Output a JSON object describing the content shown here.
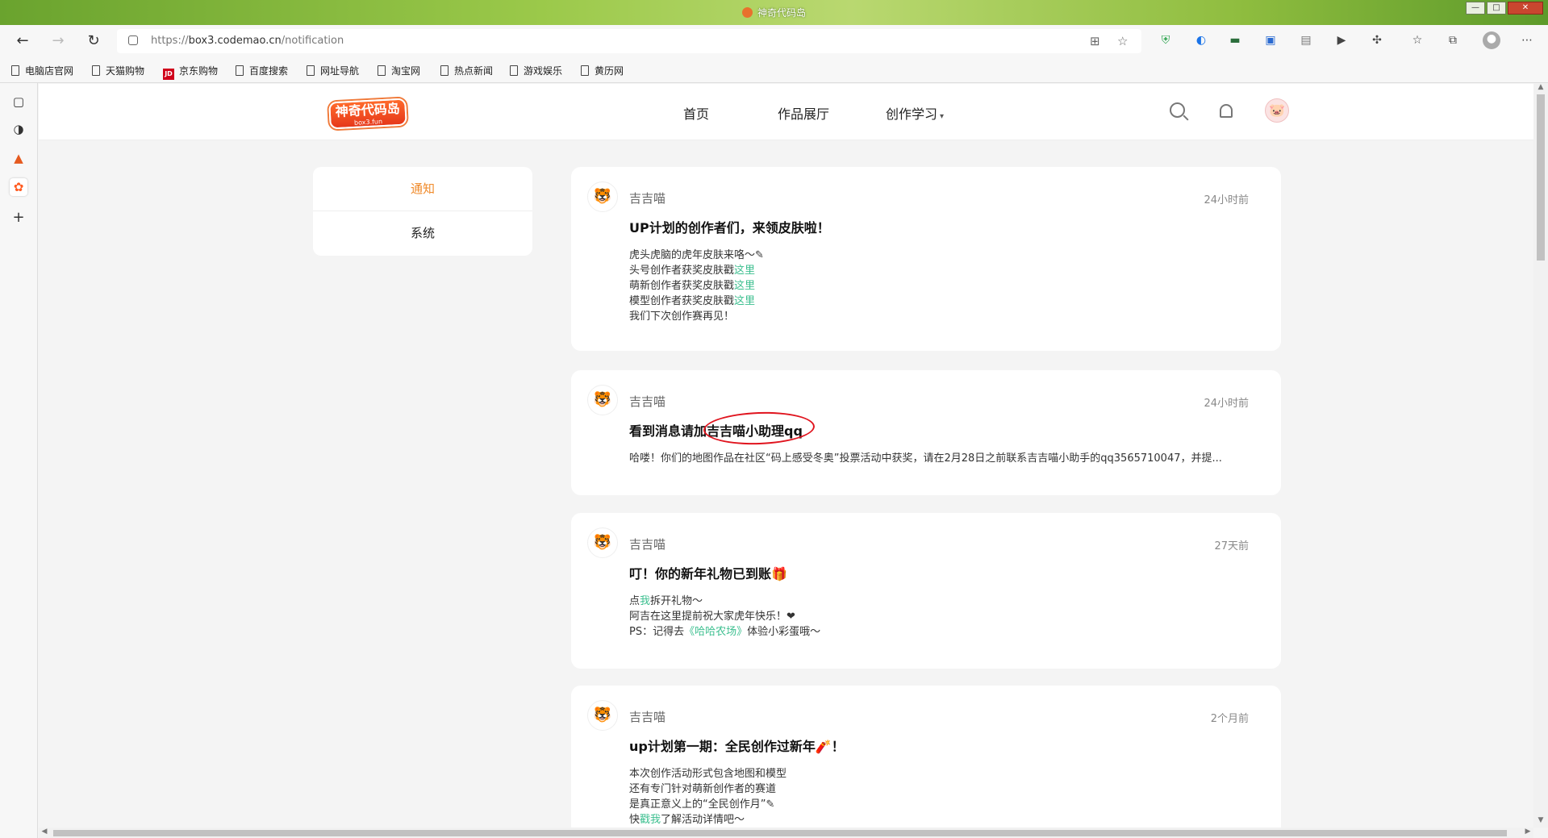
{
  "window": {
    "title": "神奇代码岛",
    "min": "—",
    "max": "□",
    "close": "✕"
  },
  "toolbar": {
    "url_prefix": "https://",
    "url_host": "box3.codemao.cn",
    "url_path": "/notification"
  },
  "bookmarks": [
    {
      "label": "电脑店官网",
      "icon": "page"
    },
    {
      "label": "天猫购物",
      "icon": "page"
    },
    {
      "label": "京东购物",
      "icon": "jd",
      "icon_text": "JD"
    },
    {
      "label": "百度搜索",
      "icon": "page"
    },
    {
      "label": "网址导航",
      "icon": "page"
    },
    {
      "label": "淘宝网",
      "icon": "page"
    },
    {
      "label": "热点新闻",
      "icon": "page"
    },
    {
      "label": "游戏娱乐",
      "icon": "page"
    },
    {
      "label": "黄历网",
      "icon": "page"
    }
  ],
  "site": {
    "logo_text": "神奇代码岛",
    "logo_sub": "box3.fun",
    "nav": [
      "首页",
      "作品展厅",
      "创作学习"
    ],
    "nav_caret": "▾"
  },
  "side_tabs": {
    "notify": "通知",
    "system": "系统"
  },
  "cards": [
    {
      "sender": "吉吉喵",
      "time": "24小时前",
      "title": "UP计划的创作者们，来领皮肤啦！",
      "lines": [
        {
          "text": "虎头虎脑的虎年皮肤来咯～✎",
          "link": ""
        },
        {
          "text": "头号创作者获奖皮肤戳",
          "link": "这里"
        },
        {
          "text": "萌新创作者获奖皮肤戳",
          "link": "这里"
        },
        {
          "text": "模型创作者获奖皮肤戳",
          "link": "这里"
        },
        {
          "text": "我们下次创作赛再见！",
          "link": ""
        }
      ]
    },
    {
      "sender": "吉吉喵",
      "time": "24小时前",
      "title": "看到消息请加吉吉喵小助理qq",
      "lines": [
        {
          "text": "哈喽！你们的地图作品在社区“码上感受冬奥”投票活动中获奖，请在2月28日之前联系吉吉喵小助手的qq3565710047，并提...",
          "link": ""
        }
      ]
    },
    {
      "sender": "吉吉喵",
      "time": "27天前",
      "title": "叮！你的新年礼物已到账🎁",
      "lines": [
        {
          "pre": "点",
          "link": "我",
          "post": "拆开礼物～"
        },
        {
          "pre": "阿吉在这里提前祝大家虎年快乐！❤",
          "link": "",
          "post": ""
        },
        {
          "pre": "PS：记得去",
          "link": "《哈哈农场》",
          "post": "体验小彩蛋哦～"
        }
      ]
    },
    {
      "sender": "吉吉喵",
      "time": "2个月前",
      "title": " up计划第一期：全民创作过新年🧨！",
      "lines": [
        {
          "pre": "本次创作活动形式包含地图和模型",
          "link": "",
          "post": ""
        },
        {
          "pre": "还有专门针对萌新创作者的赛道",
          "link": "",
          "post": ""
        },
        {
          "pre": "是真正意义上的“全民创作月”✎",
          "link": "",
          "post": ""
        },
        {
          "pre": "快",
          "link": "戳我",
          "post": "了解活动详情吧～"
        }
      ]
    }
  ],
  "colors": {
    "accent": "#f08a2a",
    "link": "#3cbf8f",
    "annotation": "#e0141e"
  }
}
